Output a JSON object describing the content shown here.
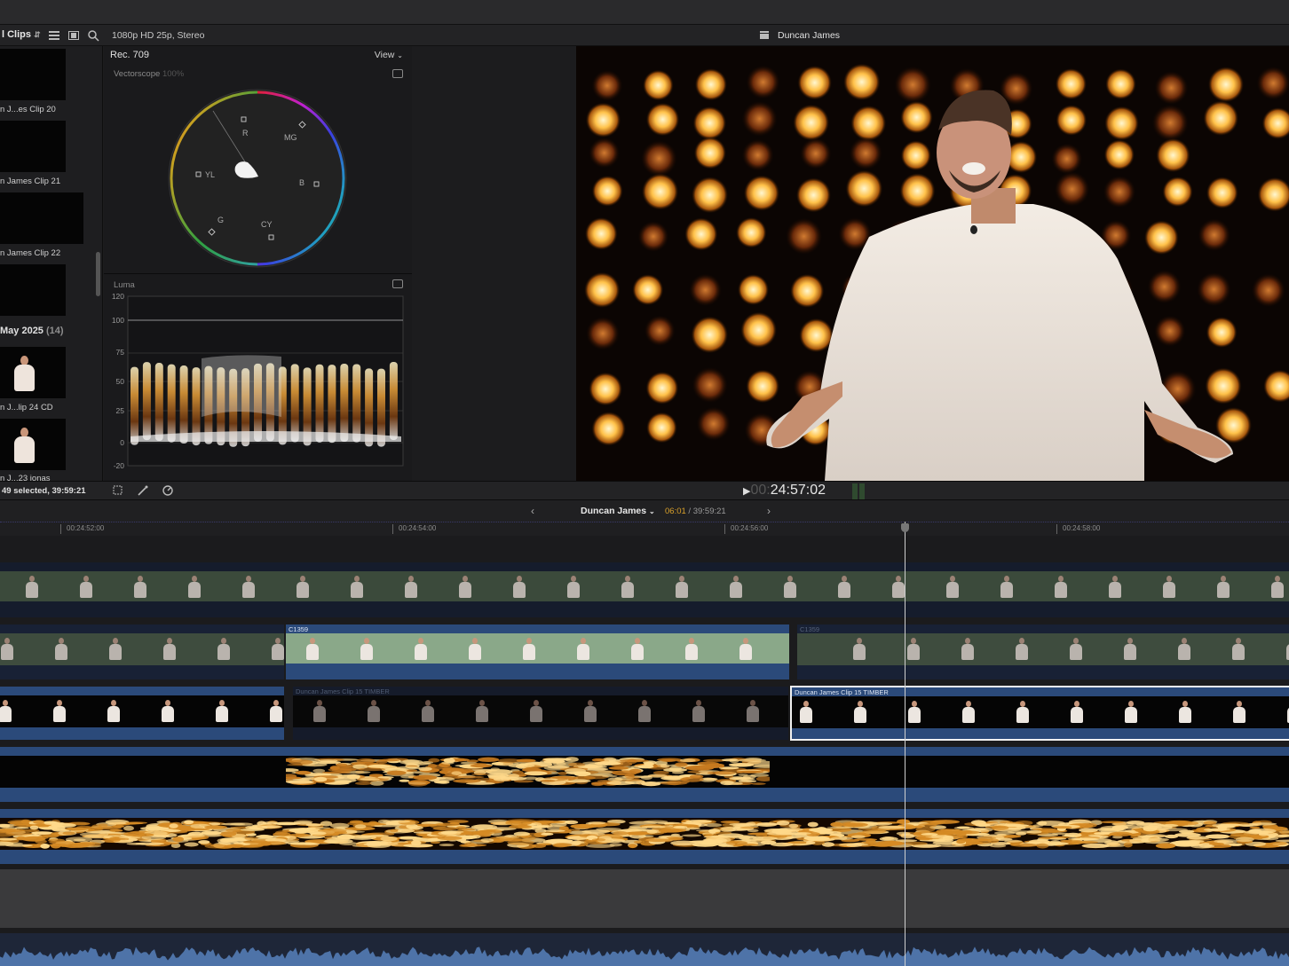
{
  "browser": {
    "title": "l Clips",
    "clips": [
      {
        "label": "n J...es Clip 20"
      },
      {
        "label": "n James Clip 21"
      },
      {
        "label": "n James Clip 22"
      },
      {
        "label": ""
      }
    ],
    "date_group": {
      "label": "May 2025",
      "count": "(14)"
    },
    "clips2": [
      {
        "label": "n J...lip 24 CD"
      },
      {
        "label": "n J...23 jonas"
      }
    ],
    "selection_status": "49 selected, 39:59:21"
  },
  "topbar": {
    "format": "1080p HD 25p, Stereo",
    "project_title": "Duncan James"
  },
  "scopes": {
    "color_space": "Rec. 709",
    "view_menu": "View",
    "vectorscope": {
      "title": "Vectorscope",
      "percent": "100%",
      "labels": [
        "R",
        "MG",
        "YL",
        "B",
        "G",
        "CY"
      ]
    },
    "luma": {
      "title": "Luma",
      "scale": [
        "120",
        "100",
        "75",
        "50",
        "25",
        "0",
        "-20"
      ]
    }
  },
  "viewer": {
    "timecode_dim": "00:",
    "timecode": "24:57:02"
  },
  "timeline": {
    "project_name": "Duncan James",
    "position": "06:01",
    "duration": "/ 39:59:21",
    "ruler": [
      "00:24:52:00",
      "00:24:54:00",
      "00:24:56:00",
      "00:24:58:00"
    ],
    "clips": {
      "c1359_a": "C1359",
      "c1359_b": "C1359",
      "timber_a": "Duncan James Clip 15 TIMBER",
      "timber_b": "Duncan James Clip 15 TIMBER"
    }
  },
  "colors": {
    "accent_blue": "#2b4a7a",
    "selection_yellow": "#d9a02a",
    "clip_green": "#6f8a6a",
    "audio_blue": "#3e5f8f"
  }
}
